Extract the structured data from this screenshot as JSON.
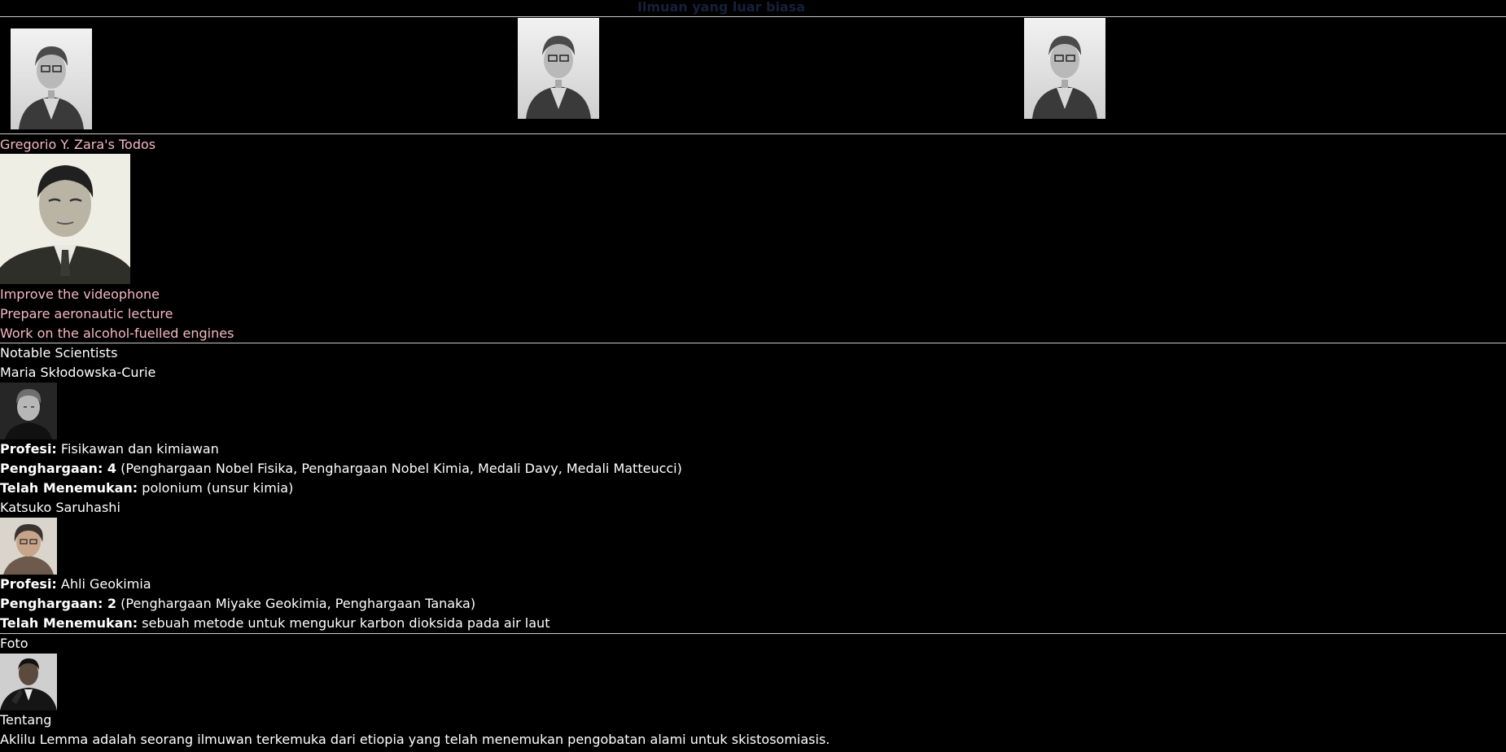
{
  "header": {
    "title": "Ilmuan yang luar biasa"
  },
  "gallery": {
    "photos": [
      {
        "icon": "portrait-woman-glasses-photo"
      },
      {
        "icon": "portrait-woman-glasses-photo"
      },
      {
        "icon": "portrait-woman-glasses-photo"
      }
    ]
  },
  "todo": {
    "title": "Gregorio Y. Zara's Todos",
    "photo_icon": "portrait-man-photo",
    "items": [
      "Improve the videophone",
      "Prepare aeronautic lecture",
      "Work on the alcohol-fuelled engines"
    ]
  },
  "scientists": {
    "heading": "Notable Scientists",
    "list": [
      {
        "name": "Maria Skłodowska-Curie",
        "photo_icon": "portrait-woman-photo",
        "profession_label": "Profesi:",
        "profession": "Fisikawan dan kimiawan",
        "awards_label": "Penghargaan: 4",
        "awards": "(Penghargaan Nobel Fisika, Penghargaan Nobel Kimia, Medali Davy, Medali Matteucci)",
        "discovered_label": "Telah Menemukan:",
        "discovered": "polonium (unsur kimia)"
      },
      {
        "name": "Katsuko Saruhashi",
        "photo_icon": "portrait-woman-glasses-photo",
        "profession_label": "Profesi:",
        "profession": "Ahli Geokimia",
        "awards_label": "Penghargaan: 2",
        "awards": "(Penghargaan Miyake Geokimia, Penghargaan Tanaka)",
        "discovered_label": "Telah Menemukan:",
        "discovered": "sebuah metode untuk mengukur karbon dioksida pada air laut"
      }
    ]
  },
  "profile": {
    "photo_label": "Foto",
    "photo_icon": "portrait-man-photo",
    "about_label": "Tentang",
    "about_text": "Aklilu Lemma adalah seorang ilmuwan terkemuka dari etiopia yang telah menemukan pengobatan alami untuk skistosomiasis."
  },
  "colors": {
    "background": "#000000",
    "text": "#ffffff",
    "todo_text": "#f7b8c8",
    "title_text": "#17203a",
    "divider": "#c9c9c9"
  }
}
